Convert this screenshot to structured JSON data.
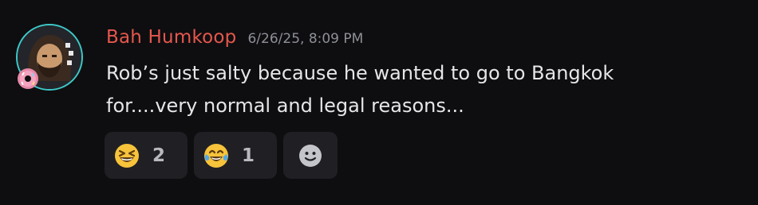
{
  "message": {
    "username": "Bah Humkoop",
    "timestamp": "6/26/25, 8:09 PM",
    "text_lines": [
      "Rob’s just salty because he wanted to go to Bangkok",
      "for....very normal and legal reasons..."
    ]
  },
  "reactions": [
    {
      "emoji": "grinning-squinting-face-icon",
      "count": "2"
    },
    {
      "emoji": "face-with-tears-of-joy-icon",
      "count": "1"
    }
  ],
  "add_reaction_icon": "smiley-add-reaction-icon",
  "colors": {
    "background": "#0e0e10",
    "username": "#e5574d",
    "timestamp": "#8e9097",
    "text": "#e6e6e8",
    "reaction_bg": "#202024",
    "avatar_ring": "#3ec8c8"
  }
}
